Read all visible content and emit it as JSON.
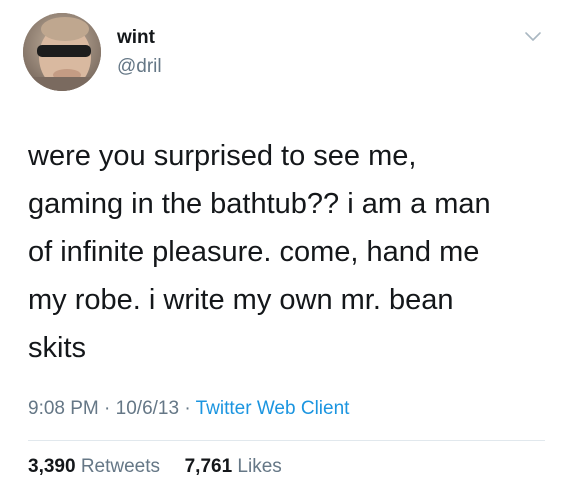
{
  "user": {
    "display_name": "wint",
    "handle": "@dril",
    "avatar_icon": "user-avatar"
  },
  "menu_icon": "chevron-down-icon",
  "tweet": {
    "text": "were you surprised to see me,\ngaming in the bathtub??  i am a man\nof infinite pleasure. come, hand me\nmy robe. i write my own mr. bean\nskits",
    "time": "9:08 PM",
    "separator": "·",
    "date": "10/6/13",
    "client": "Twitter Web Client"
  },
  "stats": {
    "retweets_count": "3,390",
    "retweets_label": "Retweets",
    "likes_count": "7,761",
    "likes_label": "Likes"
  },
  "colors": {
    "text": "#14171a",
    "secondary": "#657786",
    "link": "#1b95e0",
    "divider": "#e1e8ed"
  }
}
